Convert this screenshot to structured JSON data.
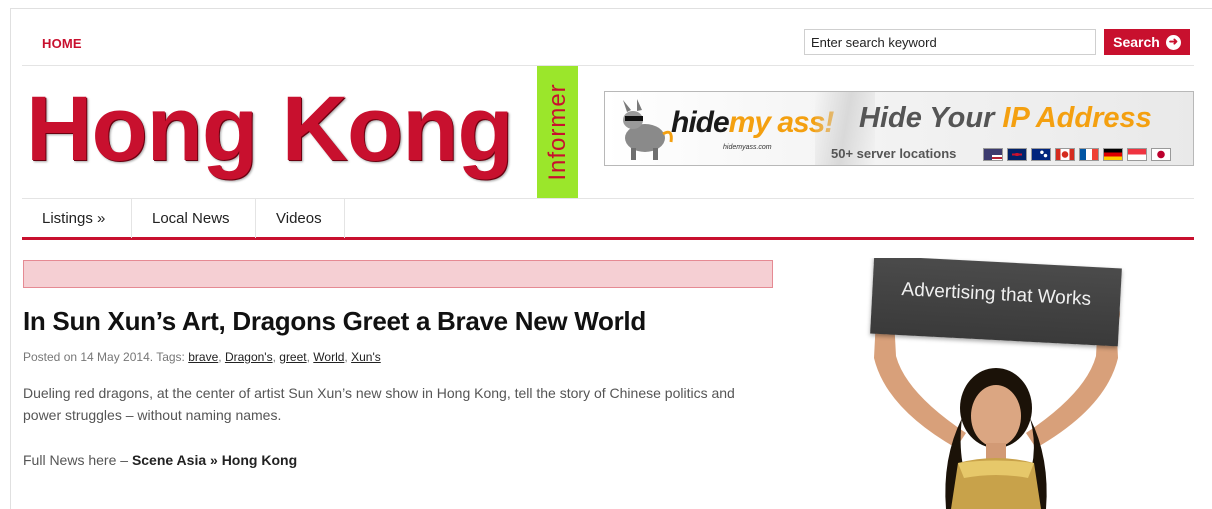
{
  "topbar": {
    "home_label": "HOME",
    "search_placeholder": "Enter search keyword",
    "search_button_label": "Search",
    "search_button_icon": "arrow-circle-right-icon"
  },
  "logo": {
    "title": "Hong Kong",
    "badge": "Informer",
    "title_color": "#c8102e",
    "badge_color": "#9be62b"
  },
  "banner": {
    "brand_main": "hide",
    "brand_accent": "my ass!",
    "brand_domain": "hidemyass.com",
    "headline_prefix": "Hide Your",
    "headline_accent": "IP Address",
    "subline": "50+ server locations",
    "accent_color": "#f4a010",
    "flags": [
      "us-flag",
      "uk-flag",
      "au-flag",
      "ca-flag",
      "fr-flag",
      "de-flag",
      "sg-flag",
      "jp-flag"
    ]
  },
  "nav": {
    "items": [
      {
        "label": "Listings »"
      },
      {
        "label": "Local News"
      },
      {
        "label": "Videos"
      }
    ],
    "accent_color": "#c8102e"
  },
  "post": {
    "title": "In Sun Xun’s Art, Dragons Greet a Brave New World",
    "posted_prefix": "Posted on 14 May 2014. Tags:",
    "tags": [
      "brave",
      "Dragon's",
      "greet",
      "World",
      "Xun's"
    ],
    "excerpt": "Dueling red dragons, at the center of artist Sun Xun’s new show in Hong Kong, tell the story of Chinese politics and power struggles – without naming names.",
    "source_prefix": "Full News here –",
    "source_link": "Scene Asia » Hong Kong"
  },
  "side_ad": {
    "sign_text": "Advertising that Works"
  }
}
